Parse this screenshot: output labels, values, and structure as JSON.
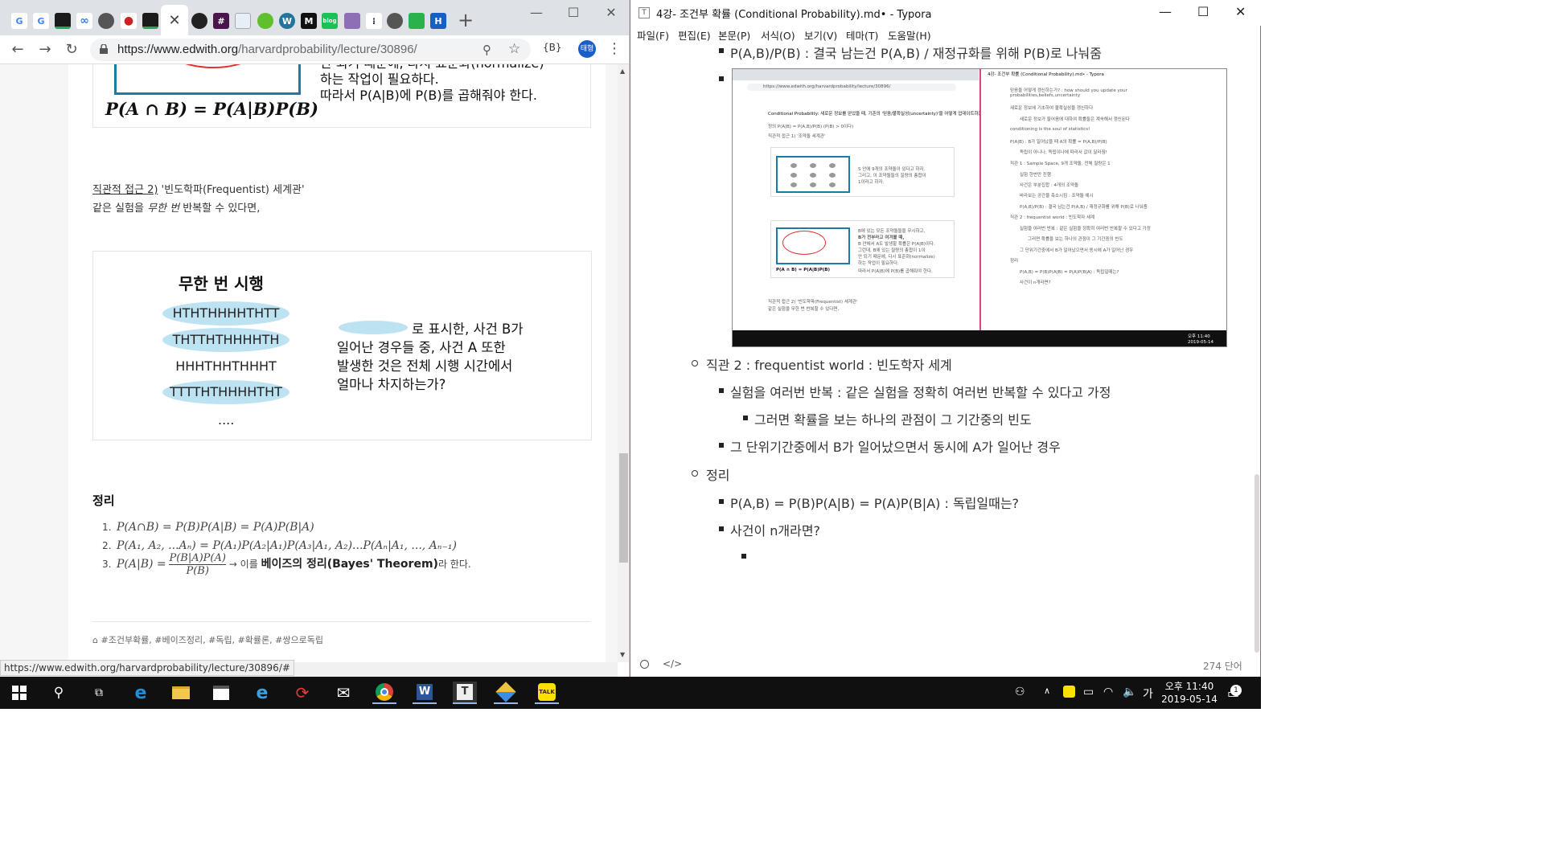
{
  "chrome": {
    "url_prefix": "https://www.edwith.org",
    "url_path": "/harvardprobability/lecture/30896/",
    "avatar_text": "태형",
    "ext_label": "{B}",
    "status_url": "https://www.edwith.org/harvardprobability/lecture/30896/#",
    "tab_icons": [
      "G",
      "G",
      "▬",
      "∞",
      "●",
      "🍄",
      "▬",
      "",
      "",
      "",
      "",
      "",
      "",
      "",
      "",
      "",
      ""
    ]
  },
  "article": {
    "fig1_formula": "P(A ∩ B) = P(A|B)P(B)",
    "fig1_lines": [
      "안 되기 때문에, 다시 표준화(normalize)",
      "하는 작업이 필요하다.",
      "따라서 P(A|B)에 P(B)를 곱해줘야 한다."
    ],
    "section_heading_link": "직관적 접근 2)",
    "section_heading_rest": " '빈도학파(Frequentist) 세계관'",
    "section_desc_a": "같은 실험을 ",
    "section_desc_em": "무한 번",
    "section_desc_b": "  반복할 수 있다면,",
    "fig2_title": "무한 번 시행",
    "trials": [
      "HTHTHHHHTHTT",
      "THTTHTHHHHTH",
      "HHHTHHTHHHT",
      "TTTTHTHHHHTHT"
    ],
    "trial_dots": "....",
    "fig2_lines": [
      "로 표시한, 사건 B가",
      "일어난 경우들 중, 사건 A 또한",
      "발생한 것은 전체 시행 시간에서",
      "얼마나 차지하는가?"
    ],
    "theorem_heading": "정리",
    "theorems": [
      {
        "num": "1.",
        "text": "P(A∩B) = P(B)P(A|B) = P(A)P(B|A)"
      },
      {
        "num": "2.",
        "text": "P(A₁, A₂, ...Aₙ) = P(A₁)P(A₂|A₁)P(A₃|A₁, A₂)...P(Aₙ|A₁, ..., Aₙ₋₁)"
      },
      {
        "num": "3.",
        "lhs": "P(A|B) =",
        "frac_num": "P(B|A)P(A)",
        "frac_den": "P(B)",
        "arrow": "→ 이를 ",
        "bold": "베이즈의 정리(Bayes' Theorem)",
        "tail": "라 한다."
      }
    ],
    "tags": "#조건부확률, #베이즈정리, #독립, #확률론, #쌍으로독립"
  },
  "typora": {
    "title": "4강- 조건부 확률 (Conditional Probability).md• - Typora",
    "menus": [
      "파일(F)",
      "편집(E)",
      "본문(P)",
      "서식(O)",
      "보기(V)",
      "테마(T)",
      "도움말(H)"
    ],
    "lines": [
      "P(A,B)/P(B) : 결국 남는건 P(A,B) / 재정규화를 위해 P(B)로 나눠줌",
      "직관 2 : frequentist world : 빈도학자 세계",
      "실험을 여러번 반복 : 같은 실험을 정확히 여러번 반복할 수 있다고 가정",
      "그러면 확률을 보는 하나의 관점이 그 기간중의 빈도",
      "그 단위기간중에서 B가 일어났으면서 동시에 A가 일어난 경우",
      "정리",
      "P(A,B) = P(B)P(A|B) = P(A)P(B|A) : 독립일때는?",
      "사건이 n개라면?"
    ],
    "word_count": "274 단어"
  },
  "embedded": {
    "url": "https://www.edwith.org/harvardprobability/lecture/30896/",
    "left_texts": [
      "Conditional Probability: 새로운 정보를 얻었을 때, 기존의 '믿음/불확실성(uncertainty)'을 어떻게 업데이트하는가?",
      "정의 P(A|B) = P(A,B)/P(B) (P(B) > 0이다)",
      "직관적 접근 1) '조약돌 세계관'",
      "S 안에 9개의 조약돌이 있다고 하자.",
      "그리고, 이 조약돌들의 질량의 총합이",
      "1이라고 하자.",
      "B에 있는 모든 조약돌들을 무시하고,",
      "B가 전부라고 여겨볼 때,",
      "B 안에서 A도 발생할 확률은 P(A|B)이다.",
      "그런데, B에 있는 질량의 총합이 1이",
      "안 되기 때문에, 다시 표준화(normalize)",
      "하는 작업이 필요하다.",
      "따라서 P(A|B)에 P(B)를 곱해줘야 한다.",
      "P(A ∩ B) = P(A|B)P(B)",
      "직관적 접근 2) '빈도학파(Frequentist) 세계관'",
      "같은 실험을 무한 번 반복할 수 있다면,"
    ],
    "right_texts": [
      "4강- 조건부 확률 (Conditional Probability).md• - Typora",
      "믿음을 어떻게 갱신하는가? : how should you update your",
      "probabilities,beliefs,uncertainty",
      "새로운 정보에 기초하여 불확실성을 갱신하다",
      "새로운 정보가 들어옴에 대하여 확률들은 계속해서 갱신된다",
      "conditioning is the soul of statistics!",
      "P(A|B) : B가 일어났을 때 A의 확률 = P(A,B)/P(B)",
      "독립이 아니나, 독립이나에 따라서 값이 달라짐!",
      "직관 1 : Sample Space, 9개 조약돌, 전체 질량은 1",
      "실험 한번만 진행",
      "사건은 부분집합 : 4개의 조약돌",
      "바라보는 공간을 축소시킴 : 조약돌 예시",
      "P(A,B)/P(B) : 결국 남는건 P(A,B) / 재정규화를 위해 P(B)로 나눠줌",
      "직관 2 : frequentist world : 빈도학자 세계",
      "실험을 여러번 반복 : 같은 실험을 정확히 여러번 반복할 수 있다고 가정",
      "그러면 확률을 보는 하나의 관점이 그 기간중의 빈도",
      "그 단위기간중에서 B가 일어났으면서 동시에 A가 일어난 경우",
      "정리",
      "P(A,B) = P(B)P(A|B) = P(A)P(B|A) : 독립일때는?",
      "사건이 n개라면?",
      "오후 11:40",
      "2019-05-14"
    ]
  },
  "taskbar": {
    "time": "오후 11:40",
    "date": "2019-05-14",
    "ime": "가",
    "notif_count": "1"
  },
  "colors": {
    "accent_blue": "#1f7aa3",
    "highlight": "#bde3f2",
    "typora_border": "#d14b8a"
  }
}
